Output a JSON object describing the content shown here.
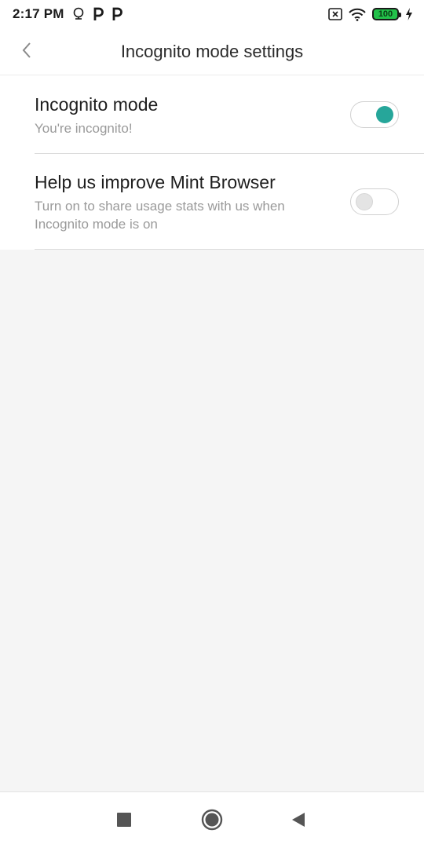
{
  "status_bar": {
    "time": "2:17 PM",
    "left_icons": [
      "notification-icon",
      "parking-icon",
      "parking-icon"
    ],
    "right_icons": [
      "sim-off-icon",
      "wifi-icon",
      "battery-icon",
      "charging-icon"
    ],
    "battery_level": "100",
    "battery_color": "#22c14a"
  },
  "header": {
    "title": "Incognito mode settings",
    "back_icon": "chevron-left-icon"
  },
  "settings": [
    {
      "title": "Incognito mode",
      "subtitle": "You're incognito!",
      "enabled": true
    },
    {
      "title": "Help us improve Mint Browser",
      "subtitle": "Turn on to share usage stats with us when Incognito mode is on",
      "enabled": false
    }
  ],
  "colors": {
    "accent": "#26a69a",
    "background": "#f5f5f5",
    "surface": "#ffffff"
  },
  "nav_bar": {
    "buttons": [
      "recents-icon",
      "home-icon",
      "back-icon"
    ]
  }
}
